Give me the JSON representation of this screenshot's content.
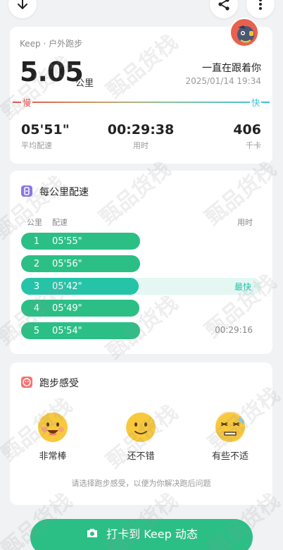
{
  "summary": {
    "source": "Keep · 户外跑步",
    "distance": "5.05",
    "distance_unit": "公里",
    "nickname": "一直在跟着你",
    "datetime": "2025/01/14 19:34",
    "slow_label": "慢",
    "fast_label": "快",
    "stats": [
      {
        "value": "05'51\"",
        "label": "平均配速"
      },
      {
        "value": "00:29:38",
        "label": "用时"
      },
      {
        "value": "406",
        "label": "千卡"
      }
    ]
  },
  "splits": {
    "title": "每公里配速",
    "col_km": "公里",
    "col_pace": "配速",
    "col_time": "用时",
    "rows": [
      {
        "km": "1",
        "pace": "05'55\"",
        "note": "",
        "fastest": false
      },
      {
        "km": "2",
        "pace": "05'56\"",
        "note": "",
        "fastest": false
      },
      {
        "km": "3",
        "pace": "05'42\"",
        "note": "最快",
        "fastest": true
      },
      {
        "km": "4",
        "pace": "05'49\"",
        "note": "",
        "fastest": false
      },
      {
        "km": "5",
        "pace": "05'54\"",
        "note": "00:29:16",
        "fastest": false
      }
    ]
  },
  "feeling": {
    "title": "跑步感受",
    "options": [
      {
        "label": "非常棒",
        "icon": "grinning-face-icon"
      },
      {
        "label": "还不错",
        "icon": "smiling-face-icon"
      },
      {
        "label": "有些不适",
        "icon": "sweating-face-icon"
      }
    ],
    "hint": "请选择跑步感受，以便为你解决跑后问题"
  },
  "cta": {
    "label": "打卡到 Keep 动态"
  },
  "watermark_text": "甄品货栈",
  "colors": {
    "accent": "#2bbf86",
    "fastest": "#25c4a8",
    "slow": "#e8534a",
    "fast": "#3cc3d6"
  }
}
